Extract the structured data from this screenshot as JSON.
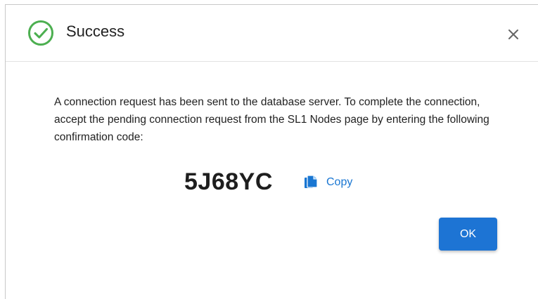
{
  "dialog": {
    "title": "Success",
    "message": "A connection request has been sent to the database server. To complete the connection, accept the pending connection request from the SL1 Nodes page by entering the following confirmation code:",
    "confirmation_code": "5J68YC",
    "copy_label": "Copy",
    "ok_label": "OK"
  },
  "icons": {
    "success": "check-circle-icon",
    "close": "close-icon",
    "copy": "copy-icon"
  },
  "colors": {
    "success_green": "#4caf50",
    "accent_blue": "#1d74d4",
    "link_blue": "#1976d2"
  }
}
